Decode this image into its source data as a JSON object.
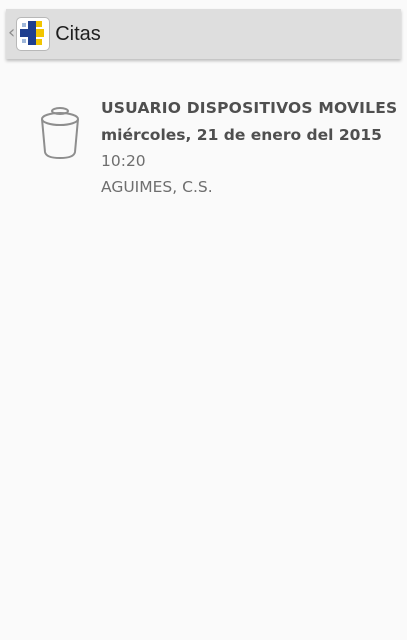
{
  "action_bar": {
    "back_icon": "chevron-left-icon",
    "app_icon": "health-cross-logo",
    "title": "Citas",
    "background_color": "#dedede"
  },
  "appointment": {
    "delete_icon": "trash-icon",
    "user_name": "USUARIO DISPOSITIVOS MOVILES",
    "date": "miércoles, 21 de enero del 2015",
    "time": "10:20",
    "center": "AGUIMES, C.S."
  }
}
